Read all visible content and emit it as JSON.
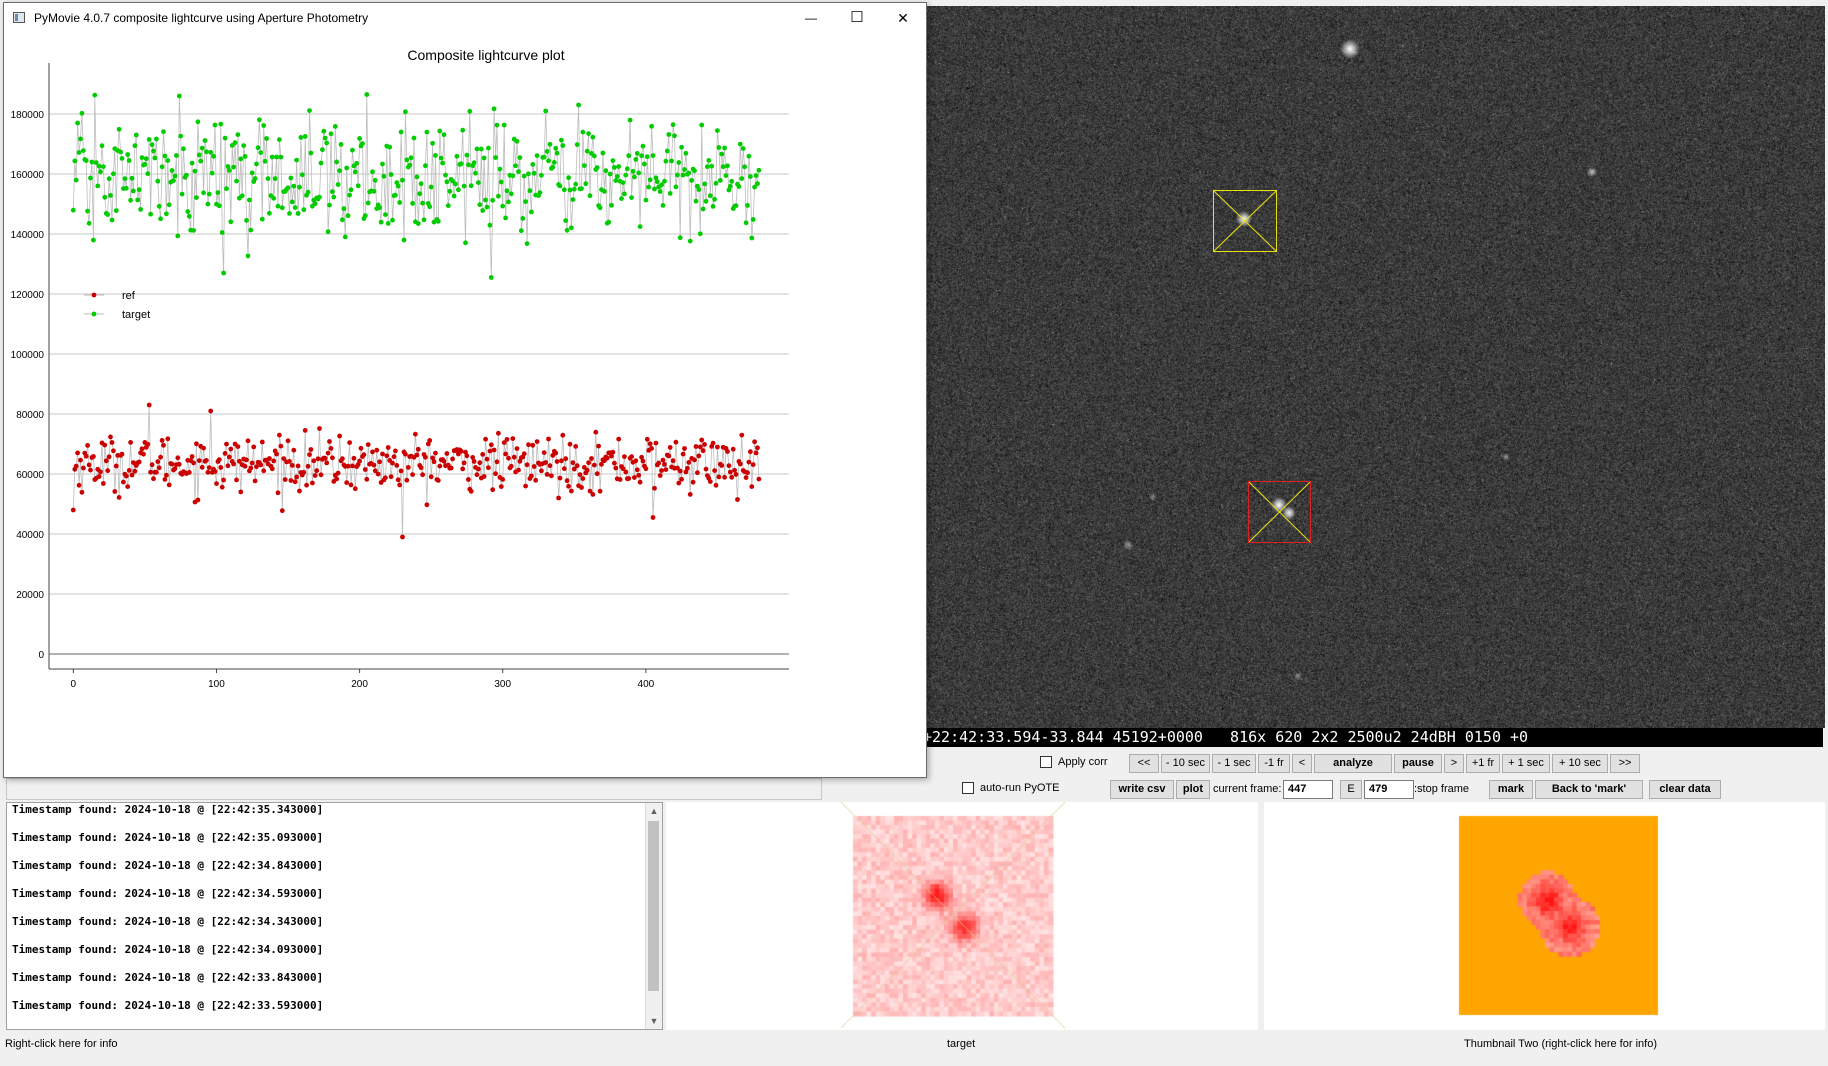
{
  "window": {
    "title": "PyMovie 4.0.7 composite lightcurve using Aperture Photometry",
    "minimize": "—",
    "maximize": "☐",
    "close": "✕"
  },
  "chart_data": {
    "type": "scatter",
    "title": "Composite lightcurve plot",
    "xlabel": "",
    "ylabel": "",
    "xlim": [
      -17,
      500
    ],
    "ylim": [
      -5000,
      197000
    ],
    "x_ticks": [
      0,
      100,
      200,
      300,
      400
    ],
    "y_ticks": [
      0,
      20000,
      40000,
      60000,
      80000,
      100000,
      120000,
      140000,
      160000,
      180000
    ],
    "grid": true,
    "legend_position": "middle-left",
    "n_points": 480,
    "series": [
      {
        "name": "ref",
        "color": "#cc0000",
        "mean": 63500,
        "spread": 4500,
        "outliers": [
          [
            0,
            48000
          ],
          [
            53,
            83000
          ],
          [
            96,
            81000
          ],
          [
            105,
            58000
          ],
          [
            230,
            39000
          ],
          [
            405,
            45500
          ],
          [
            464,
            51500
          ]
        ]
      },
      {
        "name": "target",
        "color": "#00cc00",
        "mean": 159000,
        "spread": 9500,
        "outliers": [
          [
            74,
            186000
          ],
          [
            105,
            127000
          ],
          [
            205,
            186500
          ],
          [
            292,
            125500
          ],
          [
            353,
            183000
          ],
          [
            231,
            138000
          ]
        ]
      }
    ]
  },
  "frame_overlay": {
    "text": "+22:42:33.594-33.844 45192+0000   816x 620 2x2 2500u2 24dBH 0150 +0"
  },
  "controls": {
    "apply_corr": "Apply corr",
    "auto_run": "auto-run PyOTE",
    "back10": "<<",
    "minus10sec": "- 10 sec",
    "minus1sec": "- 1 sec",
    "minus1fr": "-1 fr",
    "back1": "<",
    "analyze": "analyze",
    "pause": "pause",
    "fwd1": ">",
    "plus1fr": "+1 fr",
    "plus1sec": "+ 1 sec",
    "plus10sec": "+ 10 sec",
    "fwd10": ">>",
    "write_csv": "write csv",
    "plot": "plot",
    "current_frame_label": "current frame:",
    "current_frame": "447",
    "e_label": "E",
    "stop_frame": "479",
    "stop_frame_label": ":stop frame",
    "mark": "mark",
    "back_to_mark": "Back to 'mark'",
    "clear_data": "clear data"
  },
  "log": {
    "lines": [
      "Timestamp found: 2024-10-18 @ [22:42:35.343000]",
      "Timestamp found: 2024-10-18 @ [22:42:35.093000]",
      "Timestamp found: 2024-10-18 @ [22:42:34.843000]",
      "Timestamp found: 2024-10-18 @ [22:42:34.593000]",
      "Timestamp found: 2024-10-18 @ [22:42:34.343000]",
      "Timestamp found: 2024-10-18 @ [22:42:34.093000]",
      "Timestamp found: 2024-10-18 @ [22:42:33.843000]",
      "Timestamp found: 2024-10-18 @ [22:42:33.593000]"
    ]
  },
  "captions": {
    "left": "Right-click here for info",
    "target": "target",
    "thumb_two": "Thumbnail Two (right-click here for info)"
  },
  "colors": {
    "ref": "#cc0000",
    "target": "#00cc00",
    "target_aperture": "#e8e010",
    "ref_aperture": "#dd2020",
    "thumb_two_bg": "#ffa500"
  }
}
